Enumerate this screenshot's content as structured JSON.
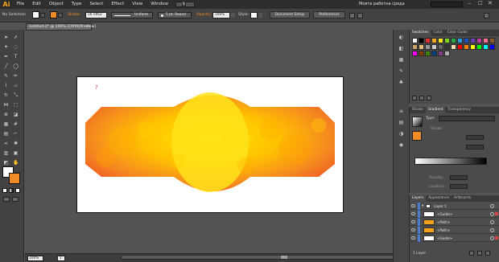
{
  "app": {
    "logo": "Ai",
    "workspace": "Моята работна среда"
  },
  "menu": [
    "File",
    "Edit",
    "Object",
    "Type",
    "Select",
    "Effect",
    "View",
    "Window",
    "Help"
  ],
  "control": {
    "selection_label": "No Selection",
    "stroke_label": "Stroke:",
    "stroke_value": "16.5952",
    "profile_value": "Uniform",
    "brush_value": "5 pt. Round",
    "opacity_label": "Opacity:",
    "opacity_value": "100%",
    "style_label": "Style:",
    "doc_setup_label": "Document Setup",
    "preferences_label": "Preferences"
  },
  "document": {
    "tab_title": "Untitled-2* @ 100% (CMYK/Preview)",
    "annotation": "?"
  },
  "status": {
    "zoom": "100%",
    "artboard_num": "1",
    "footer_text": "ВИЗИЯ ОПЦИИ"
  },
  "swatches_panel": {
    "tabs": [
      "Swatches",
      "Color",
      "Color Guide"
    ]
  },
  "gradient_panel": {
    "tabs": [
      "Stroke",
      "Gradient",
      "Transparency"
    ],
    "type_label": "Type:",
    "stroke_label": "Stroke:",
    "opacity_label": "Opacity:",
    "location_label": "Location:"
  },
  "layers_panel": {
    "tabs": [
      "Layers",
      "Appearance",
      "Artboards"
    ],
    "rows": [
      "Layer 1",
      "<Guide>",
      "<Path>",
      "<Path>",
      "<Guide>"
    ],
    "footer": "1 Layer"
  },
  "colors": {
    "accent": "#f08a24",
    "artboard": "#ffffff",
    "shape_gradient": [
      "#ffe600",
      "#ffb400",
      "#f06a1e",
      "#e23a2a"
    ],
    "swatch_colors": [
      "#ffffff",
      "#000000",
      "#e03030",
      "#f5a623",
      "#f8e71c",
      "#7ed321",
      "#2aa84a",
      "#2c9cdb",
      "#1f4fbf",
      "#6a3db5",
      "#c23ba0",
      "#ff6f91",
      "#8b5a2b",
      "#c8a46e",
      "#e5c07b",
      "#999999",
      "#cccccc",
      "#666666",
      "#333333",
      "#f0d9b5",
      "#ff0000",
      "#ff7f00",
      "#ffff00",
      "#00ff00",
      "#00ffff",
      "#0000ff",
      "#ff00ff",
      "#804000",
      "#408000",
      "#004080",
      "#804080",
      "#b0b0b0"
    ]
  }
}
